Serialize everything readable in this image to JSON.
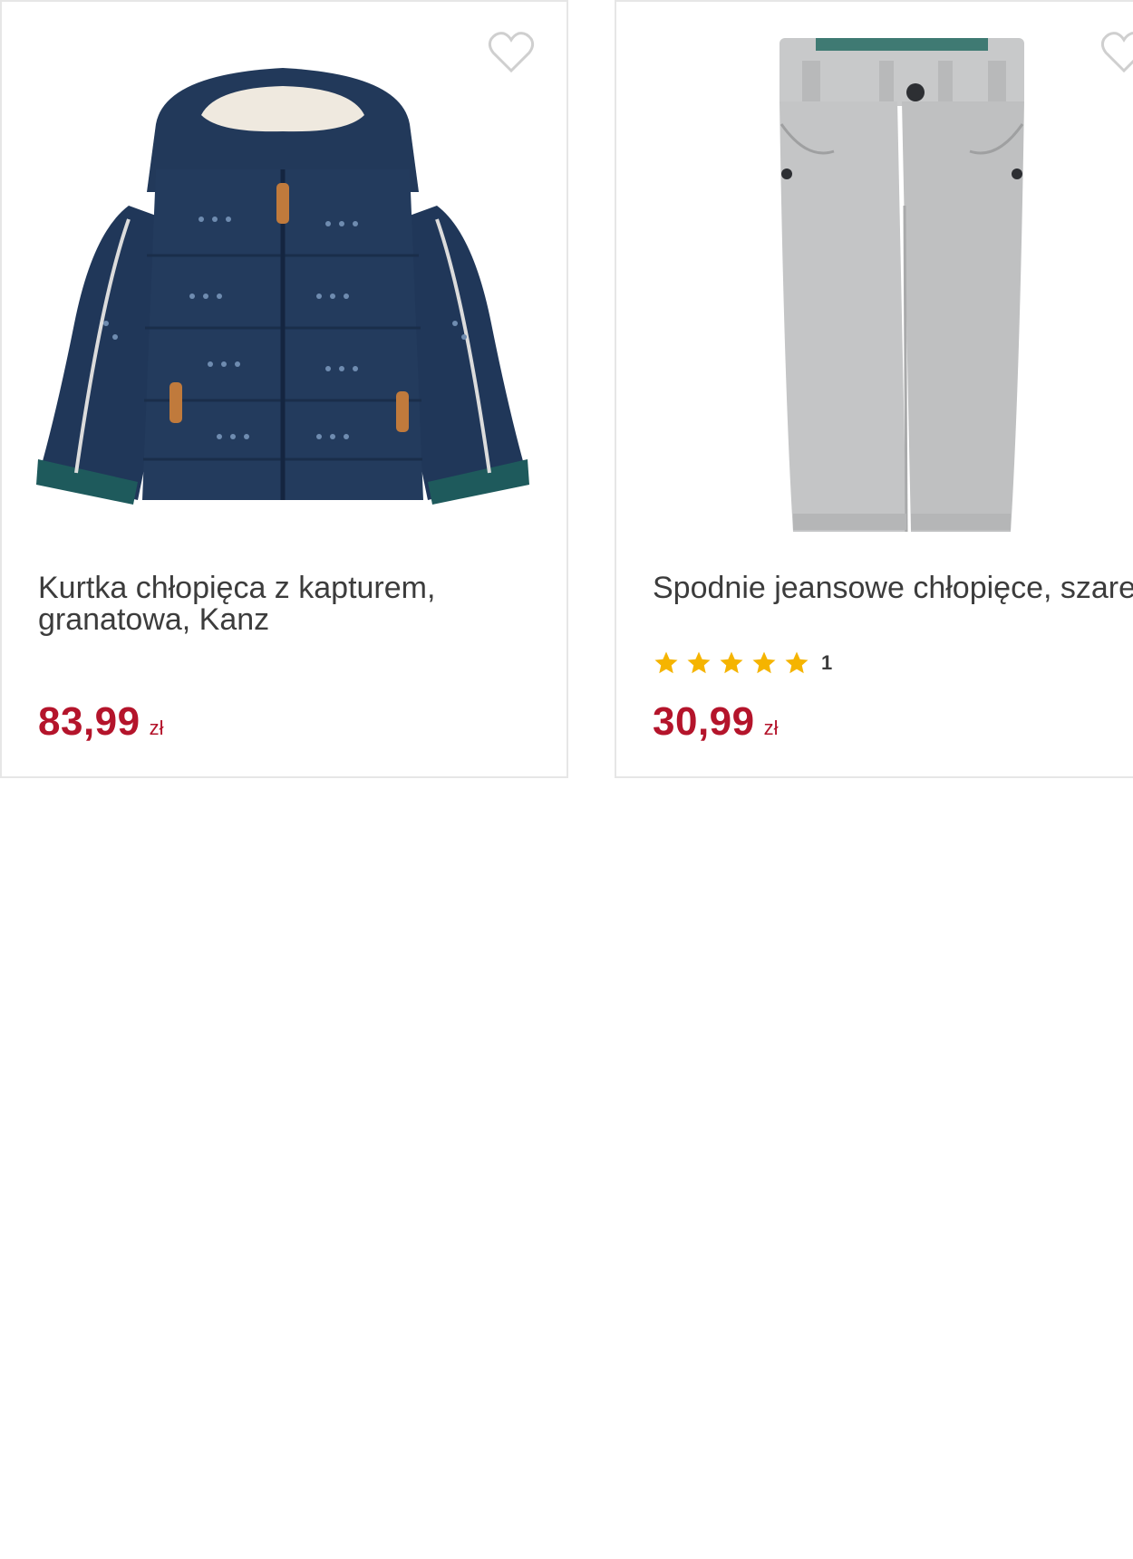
{
  "products": [
    {
      "title": "Kurtka chłopięca z kapturem, granatowa, Kanz",
      "price": "83,99",
      "currency": "zł",
      "image_icon": "jacket-image",
      "wishlist_icon": "heart-outline-icon"
    },
    {
      "title": "Spodnie jeansowe chłopięce, szare, Kanz",
      "price": "30,99",
      "currency": "zł",
      "rating_stars": 5,
      "rating_count": "1",
      "image_icon": "jeans-image",
      "wishlist_icon": "heart-outline-icon"
    }
  ],
  "colors": {
    "price": "#b4142b",
    "star": "#f5b400",
    "jacket": "#1f3656",
    "jeans": "#c4c5c6"
  }
}
